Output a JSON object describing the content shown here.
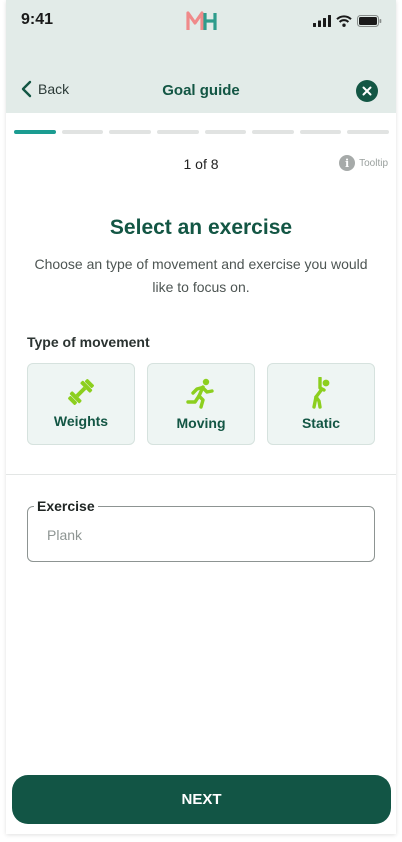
{
  "status_bar": {
    "time": "9:41"
  },
  "nav": {
    "back_label": "Back",
    "title": "Goal guide"
  },
  "progress": {
    "total_steps": 8,
    "current_step": 1
  },
  "step_counter": "1 of 8",
  "tooltip": {
    "label": "Tooltip",
    "icon_glyph": "i"
  },
  "heading": "Select an exercise",
  "subtext": "Choose an type of movement and exercise you would like to focus on.",
  "movement": {
    "label": "Type of movement",
    "options": [
      {
        "label": "Weights",
        "icon": "dumbbell-icon"
      },
      {
        "label": "Moving",
        "icon": "running-icon"
      },
      {
        "label": "Static",
        "icon": "stretching-icon"
      }
    ]
  },
  "exercise_field": {
    "label": "Exercise",
    "placeholder": "Plank"
  },
  "next_button": {
    "label": "NEXT"
  },
  "colors": {
    "header_bg": "#e2ebe8",
    "brand_dark_green": "#135644",
    "progress_active": "#1b9c91",
    "icon_lime": "#8ccf1e",
    "card_bg": "#eef5f3",
    "button_bg": "#125545"
  }
}
